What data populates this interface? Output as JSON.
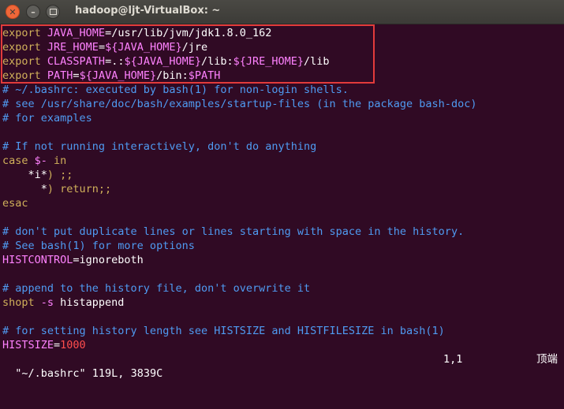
{
  "window": {
    "title": "hadoop@ljt-VirtualBox: ~",
    "close_icon": "close-icon",
    "minimize_icon": "minimize-icon",
    "maximize_icon": "maximize-icon"
  },
  "colors": {
    "background": "#300a24",
    "keyword": "#d0b05a",
    "variable": "#ff82ff",
    "comment": "#4f9bf2",
    "highlight_box": "#e23b3b",
    "number": "#ff4d4d"
  },
  "lines": [
    [
      {
        "t": "export",
        "c": "key"
      },
      {
        "t": " JAVA_HOME",
        "c": "var"
      },
      {
        "t": "=/usr/lib/jvm/jdk1.8.0_162",
        "c": "lit"
      }
    ],
    [
      {
        "t": "export",
        "c": "key"
      },
      {
        "t": " JRE_HOME",
        "c": "var"
      },
      {
        "t": "=",
        "c": "lit"
      },
      {
        "t": "${JAVA_HOME}",
        "c": "var"
      },
      {
        "t": "/jre",
        "c": "lit"
      }
    ],
    [
      {
        "t": "export",
        "c": "key"
      },
      {
        "t": " CLASSPATH",
        "c": "var"
      },
      {
        "t": "=.:",
        "c": "lit"
      },
      {
        "t": "${JAVA_HOME}",
        "c": "var"
      },
      {
        "t": "/lib:",
        "c": "lit"
      },
      {
        "t": "${JRE_HOME}",
        "c": "var"
      },
      {
        "t": "/lib",
        "c": "lit"
      }
    ],
    [
      {
        "t": "export",
        "c": "key"
      },
      {
        "t": " PATH",
        "c": "var"
      },
      {
        "t": "=",
        "c": "lit"
      },
      {
        "t": "${JAVA_HOME}",
        "c": "var"
      },
      {
        "t": "/bin:",
        "c": "lit"
      },
      {
        "t": "$PATH",
        "c": "var"
      }
    ],
    [
      {
        "t": "# ~/.bashrc: executed by bash(1) for non-login shells.",
        "c": "cmt"
      }
    ],
    [
      {
        "t": "# see /usr/share/doc/bash/examples/startup-files (in the package bash-doc)",
        "c": "cmt"
      }
    ],
    [
      {
        "t": "# for examples",
        "c": "cmt"
      }
    ],
    [],
    [
      {
        "t": "# If not running interactively, don't do anything",
        "c": "cmt"
      }
    ],
    [
      {
        "t": "case",
        "c": "key"
      },
      {
        "t": " $-",
        "c": "var"
      },
      {
        "t": " in",
        "c": "key"
      }
    ],
    [
      {
        "t": "    *i*",
        "c": "lit"
      },
      {
        "t": ") ;;",
        "c": "key"
      }
    ],
    [
      {
        "t": "      *",
        "c": "lit"
      },
      {
        "t": ") return;;",
        "c": "key"
      }
    ],
    [
      {
        "t": "esac",
        "c": "key"
      }
    ],
    [],
    [
      {
        "t": "# don't put duplicate lines or lines starting with space in the history.",
        "c": "cmt"
      }
    ],
    [
      {
        "t": "# See bash(1) for more options",
        "c": "cmt"
      }
    ],
    [
      {
        "t": "HISTCONTROL",
        "c": "var"
      },
      {
        "t": "=ignoreboth",
        "c": "lit"
      }
    ],
    [],
    [
      {
        "t": "# append to the history file, don't overwrite it",
        "c": "cmt"
      }
    ],
    [
      {
        "t": "shopt",
        "c": "key"
      },
      {
        "t": " -s",
        "c": "var"
      },
      {
        "t": " histappend",
        "c": "lit"
      }
    ],
    [],
    [
      {
        "t": "# for setting history length see HISTSIZE and HISTFILESIZE in bash(1)",
        "c": "cmt"
      }
    ],
    [
      {
        "t": "HISTSIZE",
        "c": "var"
      },
      {
        "t": "=",
        "c": "lit"
      },
      {
        "t": "1000",
        "c": "red"
      }
    ]
  ],
  "status": {
    "file_info": "\"~/.bashrc\" 119L, 3839C",
    "cursor_pos": "1,1",
    "scroll": "顶端"
  }
}
